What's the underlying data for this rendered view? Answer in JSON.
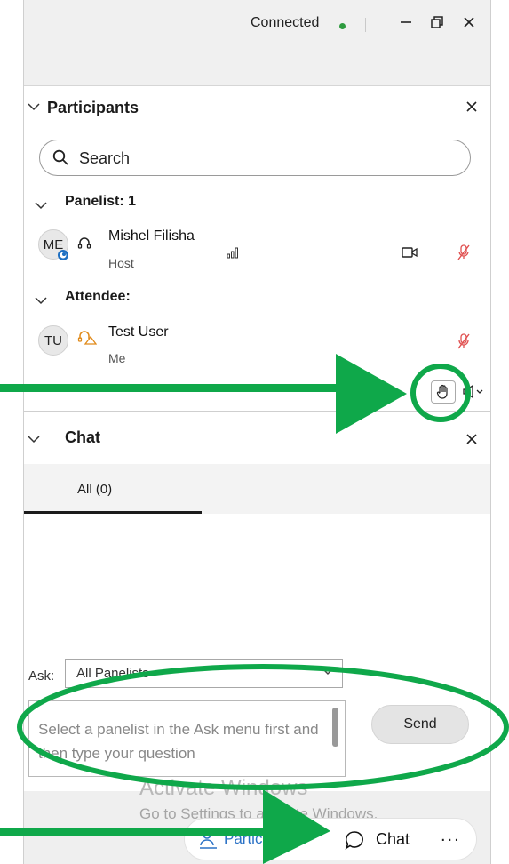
{
  "titlebar": {
    "status": "Connected",
    "status_color": "#2e9b3f",
    "minimize_icon": "minimize-icon",
    "restore_icon": "restore-icon",
    "close_icon": "close-icon"
  },
  "participants": {
    "title": "Participants",
    "search_placeholder": "Search",
    "groups": [
      {
        "label": "Panelist: 1",
        "members": [
          {
            "initials": "ME",
            "name": "Mishel Filisha",
            "role": "Host"
          }
        ]
      },
      {
        "label": "Attendee:",
        "members": [
          {
            "initials": "TU",
            "name": "Test User",
            "role": "Me"
          }
        ]
      }
    ]
  },
  "chat": {
    "title": "Chat",
    "tab": "All (0)",
    "ask_label": "Ask:",
    "ask_value": "All Panelists",
    "message_placeholder": "Select a panelist in the Ask menu first and then type your question",
    "send_label": "Send"
  },
  "watermark": {
    "line1": "Activate Windows",
    "line2": "Go to Settings to activate Windows."
  },
  "bottom": {
    "participants_label": "Partic",
    "chat_label": "Chat",
    "more_label": "..."
  },
  "colors": {
    "accent_blue": "#2b72c6",
    "muted_red": "#e05050",
    "annotation_green": "#0fa84a"
  }
}
